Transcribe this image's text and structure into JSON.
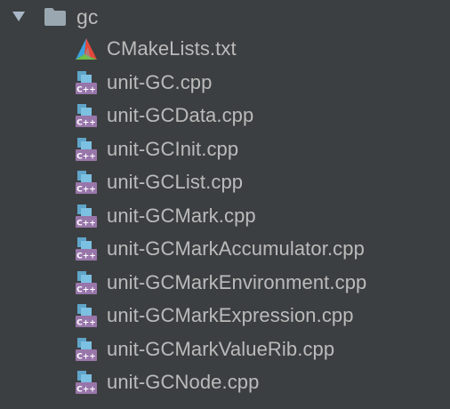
{
  "tree": {
    "folder": {
      "name": "gc",
      "expanded": true,
      "icon": "folder-icon",
      "arrow_icon": "triangle-down-icon"
    },
    "files": [
      {
        "name": "CMakeLists.txt",
        "icon": "cmake-icon"
      },
      {
        "name": "unit-GC.cpp",
        "icon": "cpp-file-icon",
        "badge": "C++"
      },
      {
        "name": "unit-GCData.cpp",
        "icon": "cpp-file-icon",
        "badge": "C++"
      },
      {
        "name": "unit-GCInit.cpp",
        "icon": "cpp-file-icon",
        "badge": "C++"
      },
      {
        "name": "unit-GCList.cpp",
        "icon": "cpp-file-icon",
        "badge": "C++"
      },
      {
        "name": "unit-GCMark.cpp",
        "icon": "cpp-file-icon",
        "badge": "C++"
      },
      {
        "name": "unit-GCMarkAccumulator.cpp",
        "icon": "cpp-file-icon",
        "badge": "C++"
      },
      {
        "name": "unit-GCMarkEnvironment.cpp",
        "icon": "cpp-file-icon",
        "badge": "C++"
      },
      {
        "name": "unit-GCMarkExpression.cpp",
        "icon": "cpp-file-icon",
        "badge": "C++"
      },
      {
        "name": "unit-GCMarkValueRib.cpp",
        "icon": "cpp-file-icon",
        "badge": "C++"
      },
      {
        "name": "unit-GCNode.cpp",
        "icon": "cpp-file-icon",
        "badge": "C++"
      }
    ]
  },
  "colors": {
    "background": "#3c3f41",
    "text": "#bbbbbb",
    "folder": "#9aa7b0",
    "cpp_badge": "#9876aa",
    "cpp_page": "#5fa4c9"
  }
}
